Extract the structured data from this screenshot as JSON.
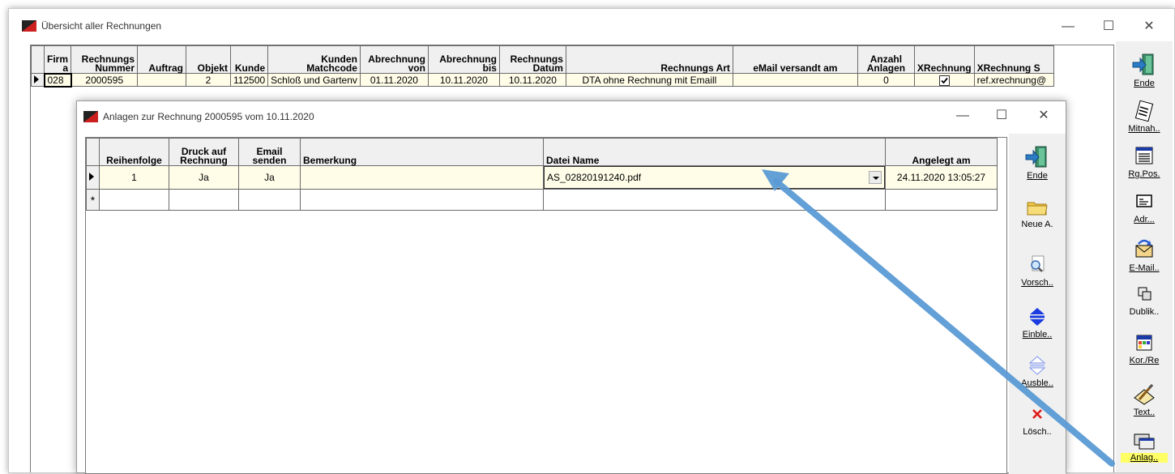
{
  "main_window": {
    "title": "Übersicht aller Rechnungen",
    "controls": {
      "minimize": "—",
      "maximize": "☐",
      "close": "✕"
    },
    "columns": [
      {
        "line1": "Firm",
        "line2": "a"
      },
      {
        "line1": "Rechnungs",
        "line2": "Nummer"
      },
      {
        "line1": "",
        "line2": "Auftrag"
      },
      {
        "line1": "",
        "line2": "Objekt"
      },
      {
        "line1": "",
        "line2": "Kunde"
      },
      {
        "line1": "Kunden",
        "line2": "Matchcode"
      },
      {
        "line1": "Abrechnung",
        "line2": "von"
      },
      {
        "line1": "Abrechnung",
        "line2": "bis"
      },
      {
        "line1": "Rechnungs",
        "line2": "Datum"
      },
      {
        "line1": "",
        "line2": "Rechnungs Art"
      },
      {
        "line1": "",
        "line2": "eMail versandt am"
      },
      {
        "line1": "Anzahl",
        "line2": "Anlagen"
      },
      {
        "line1": "",
        "line2": "XRechnung"
      },
      {
        "line1": "",
        "line2": "XRechnung S"
      }
    ],
    "row": {
      "firma": "028",
      "nummer": "2000595",
      "auftrag": "",
      "objekt": "2",
      "kunde": "112500",
      "matchcode": "Schloß und Gartenv",
      "von": "01.11.2020",
      "bis": "10.11.2020",
      "datum": "10.11.2020",
      "art": "DTA ohne Rechnung mit Emaill",
      "email_versandt": "",
      "anlagen": "0",
      "xrechnung_checked": true,
      "xrechnung_s": "ref.xrechnung@"
    }
  },
  "main_sidebar": [
    {
      "label": "Ende",
      "icon": "exit-door-icon"
    },
    {
      "label": "Mitnah..",
      "icon": "notebook-icon"
    },
    {
      "label": "Rg.Pos.",
      "icon": "list-window-icon"
    },
    {
      "label": "Adr...",
      "icon": "address-card-icon"
    },
    {
      "label": "E-Mail..",
      "icon": "email-icon"
    },
    {
      "label": "Dublik..",
      "icon": "duplicate-icon"
    },
    {
      "label": "Kor./Re",
      "icon": "calendar-icon"
    },
    {
      "label": "Text..",
      "icon": "pen-paper-icon"
    },
    {
      "label": "Anlag..",
      "icon": "attachments-icon"
    }
  ],
  "dialog": {
    "title": "Anlagen zur Rechnung  2000595 vom 10.11.2020",
    "controls": {
      "minimize": "—",
      "maximize": "☐",
      "close": "✕"
    },
    "columns": [
      {
        "line1": "",
        "line2": "Reihenfolge"
      },
      {
        "line1": "Druck auf",
        "line2": "Rechnung"
      },
      {
        "line1": "Email",
        "line2": "senden"
      },
      {
        "line1": "",
        "line2": "Bemerkung"
      },
      {
        "line1": "",
        "line2": "Datei Name"
      },
      {
        "line1": "",
        "line2": "Angelegt am"
      }
    ],
    "row": {
      "reihenfolge": "1",
      "druck": "Ja",
      "email": "Ja",
      "bemerkung": "",
      "datei": "AS_02820191240.pdf",
      "angelegt": "24.11.2020 13:05:27"
    },
    "new_row_marker": "*",
    "sidebar": [
      {
        "label": "Ende",
        "icon": "exit-door-icon"
      },
      {
        "label": "Neue A.",
        "icon": "folder-icon"
      },
      {
        "label": "Vorsch..",
        "icon": "magnifier-icon"
      },
      {
        "label": "Einble..",
        "icon": "move-in-icon"
      },
      {
        "label": "Ausble..",
        "icon": "move-out-icon"
      },
      {
        "label": "Lösch..",
        "icon": "delete-icon"
      }
    ]
  },
  "colors": {
    "row_highlight": "#fffde8",
    "highlight_button": "#ffff66",
    "annotation_arrow": "#5b9bd5",
    "app_icon_red": "#cc1f1f"
  }
}
